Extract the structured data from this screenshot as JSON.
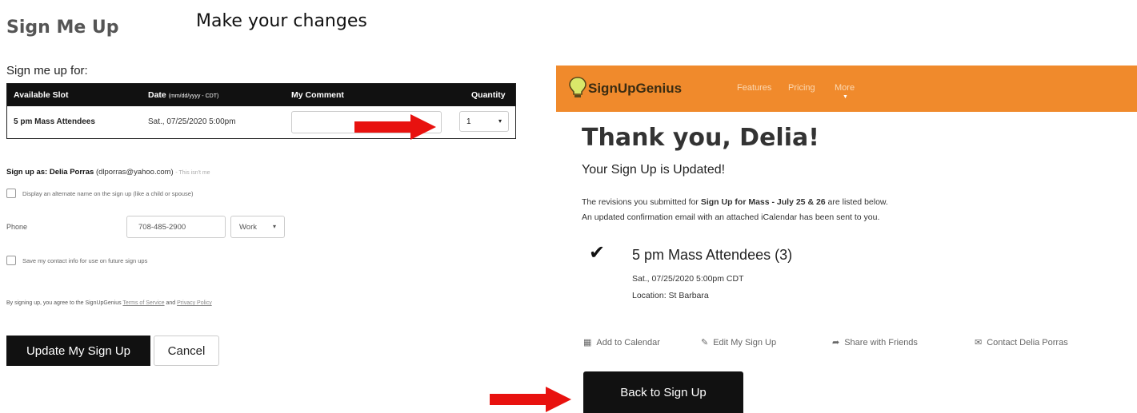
{
  "caption": "Make your changes",
  "left": {
    "title": "Sign Me Up",
    "sign_up_for": "Sign me up for:",
    "table": {
      "headers": {
        "slot": "Available Slot",
        "date": "Date",
        "date_format": "(mm/dd/yyyy - CDT)",
        "comment": "My Comment",
        "quantity": "Quantity"
      },
      "row": {
        "slot": "5 pm Mass Attendees",
        "date": "Sat., 07/25/2020 5:00pm",
        "comment": "",
        "quantity": "1"
      }
    },
    "sign_up_as_label": "Sign up as:",
    "user_name": "Delia Porras",
    "user_email": "(dlporras@yahoo.com)",
    "not_me": "- This isn't me",
    "alternate_name": "Display an alternate name on the sign up (like a child or spouse)",
    "phone_label": "Phone",
    "phone_value": "708-485-2900",
    "phone_type": "Work",
    "save_contact": "Save my contact info for use on future sign ups",
    "terms_prefix": "By signing up, you agree to the SignUpGenius",
    "terms_link": "Terms of Service",
    "terms_and": "and",
    "privacy_link": "Privacy Policy",
    "update_button": "Update My Sign Up",
    "cancel_button": "Cancel"
  },
  "right": {
    "logo": "SignUpGenius",
    "nav": [
      "Features",
      "Pricing",
      "More"
    ],
    "thank_you": "Thank you, Delia!",
    "updated": "Your Sign Up is Updated!",
    "rev_prefix": "The revisions you submitted for",
    "rev_signup": "Sign Up for Mass - July 25 & 26",
    "rev_suffix": "are listed below.",
    "rev_line2": "An updated confirmation email with an attached iCalendar has been sent to you.",
    "slot_confirmed": "5 pm Mass Attendees (3)",
    "slot_datetime": "Sat., 07/25/2020 5:00pm CDT",
    "slot_location": "Location: St Barbara",
    "actions": {
      "add_calendar": "Add to Calendar",
      "edit_signup": "Edit My Sign Up",
      "share": "Share with Friends",
      "contact": "Contact Delia Porras"
    },
    "back_button": "Back to Sign Up"
  },
  "colors": {
    "nav_orange": "#f08a2c",
    "arrow_red": "#e8120f",
    "button_black": "#111111"
  }
}
